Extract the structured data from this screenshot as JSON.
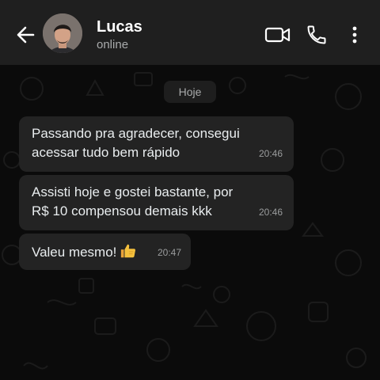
{
  "header": {
    "contact_name": "Lucas",
    "contact_status": "online",
    "icons": [
      "back-arrow-icon",
      "video-call-icon",
      "phone-call-icon",
      "more-options-icon"
    ]
  },
  "chat": {
    "date_label": "Hoje",
    "messages": [
      {
        "text": "Passando pra agradecer, consegui\nacessar tudo bem rápido",
        "time": "20:46"
      },
      {
        "text": "Assisti hoje e gostei bastante, por\nR$ 10 compensou demais kkk",
        "time": "20:46"
      },
      {
        "text": "Valeu mesmo!",
        "time": "20:47",
        "emoji": "thumbs-up-icon"
      }
    ]
  },
  "colors": {
    "header_bg": "#1f1f1f",
    "chat_bg": "#0b0b0b",
    "bubble_bg": "#232323",
    "text_primary": "#e9edef",
    "text_secondary": "#a9abac"
  }
}
